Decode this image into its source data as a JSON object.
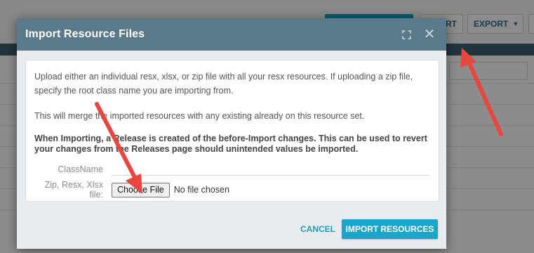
{
  "background": {
    "toolbar": {
      "import_label": "RT",
      "export_label": "EXPORT"
    }
  },
  "dialog": {
    "title": "Import Resource Files",
    "body": {
      "paragraph1": "Upload either an individual resx, xlsx, or zip file with all your resx resources. If uploading a zip file, specify the root class name you are importing from.",
      "paragraph2": "This will merge the imported resources with any existing already on this resource set.",
      "paragraph3": "When Importing, a Release is created of the before-Import changes. This can be used to revert your changes from the Releases page should unintended values be imported.",
      "classname_label": "ClassName",
      "classname_value": "",
      "file_label": "Zip, Resx, Xlsx file:",
      "file_button_label": "Choose File",
      "file_status": "No file chosen"
    },
    "footer": {
      "cancel_label": "CANCEL",
      "import_label": "IMPORT RESOURCES"
    }
  },
  "colors": {
    "header": "#5a7a8a",
    "primary": "#18a7c8",
    "annotation_arrow": "#e8473f"
  }
}
